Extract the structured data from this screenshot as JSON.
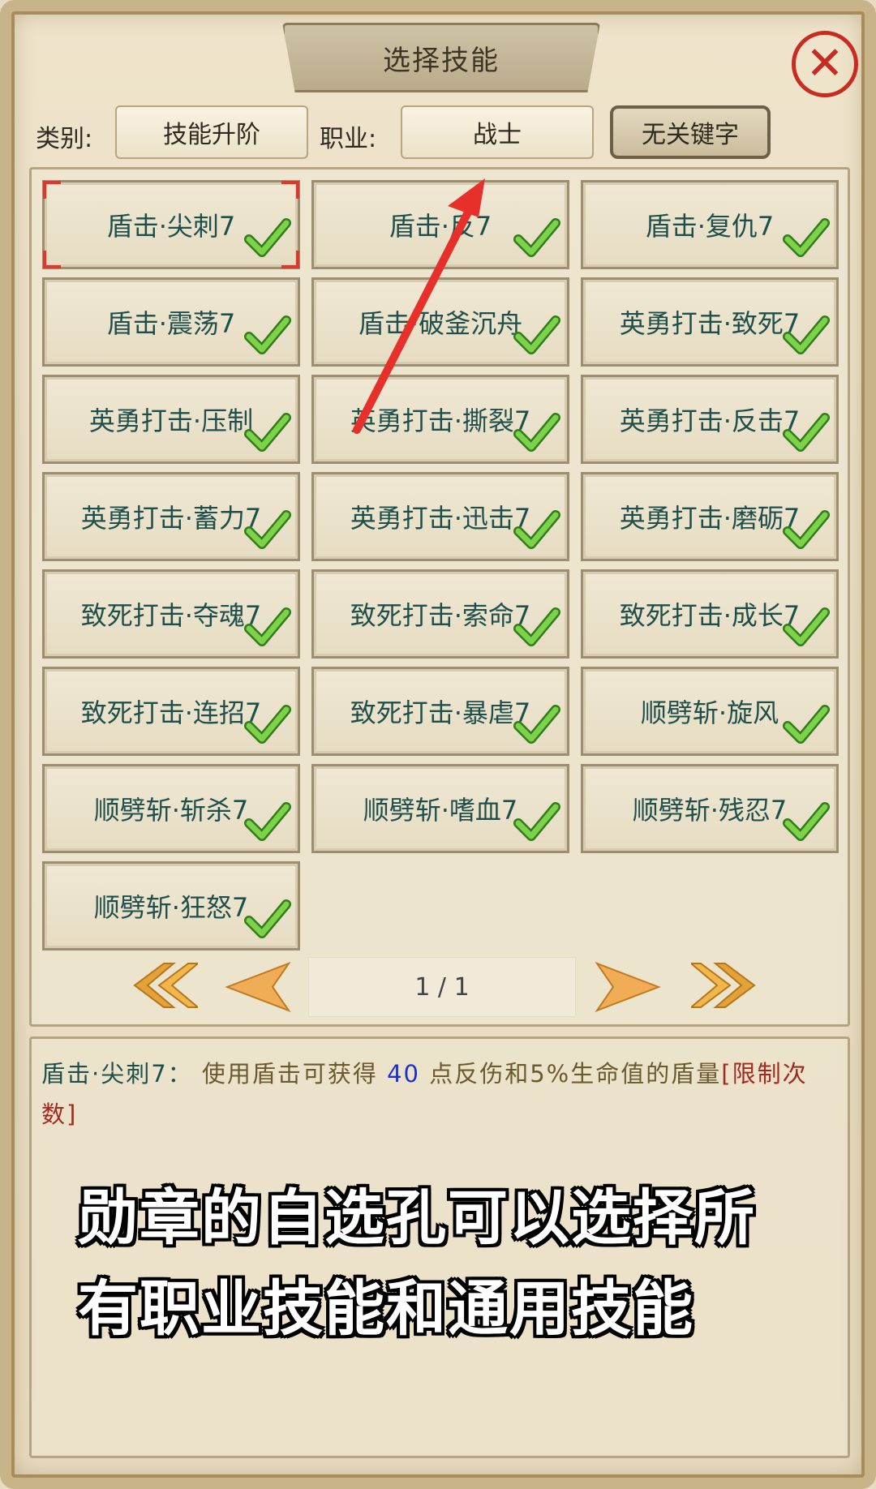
{
  "dialog": {
    "title": "选择技能",
    "close_icon": "close-x-icon",
    "accent_color": "#c92a22"
  },
  "filters": {
    "category_label": "类别:",
    "category_value": "技能升阶",
    "class_label": "职业:",
    "class_value": "战士",
    "keyword_button": "无关键字"
  },
  "skills": [
    {
      "name": "盾击·尖刺7",
      "checked": true,
      "selected": true
    },
    {
      "name": "盾击·反7",
      "checked": true,
      "selected": false
    },
    {
      "name": "盾击·复仇7",
      "checked": true,
      "selected": false
    },
    {
      "name": "盾击·震荡7",
      "checked": true,
      "selected": false
    },
    {
      "name": "盾击·破釜沉舟",
      "checked": true,
      "selected": false
    },
    {
      "name": "英勇打击·致死7",
      "checked": true,
      "selected": false
    },
    {
      "name": "英勇打击·压制",
      "checked": true,
      "selected": false
    },
    {
      "name": "英勇打击·撕裂7",
      "checked": true,
      "selected": false
    },
    {
      "name": "英勇打击·反击7",
      "checked": true,
      "selected": false
    },
    {
      "name": "英勇打击·蓄力7",
      "checked": true,
      "selected": false
    },
    {
      "name": "英勇打击·迅击7",
      "checked": true,
      "selected": false
    },
    {
      "name": "英勇打击·磨砺7",
      "checked": true,
      "selected": false
    },
    {
      "name": "致死打击·夺魂7",
      "checked": true,
      "selected": false
    },
    {
      "name": "致死打击·索命7",
      "checked": true,
      "selected": false
    },
    {
      "name": "致死打击·成长7",
      "checked": true,
      "selected": false
    },
    {
      "name": "致死打击·连招7",
      "checked": true,
      "selected": false
    },
    {
      "name": "致死打击·暴虐7",
      "checked": true,
      "selected": false
    },
    {
      "name": "顺劈斩·旋风",
      "checked": true,
      "selected": false
    },
    {
      "name": "顺劈斩·斩杀7",
      "checked": true,
      "selected": false
    },
    {
      "name": "顺劈斩·嗜血7",
      "checked": true,
      "selected": false
    },
    {
      "name": "顺劈斩·残忍7",
      "checked": true,
      "selected": false
    },
    {
      "name": "顺劈斩·狂怒7",
      "checked": true,
      "selected": false
    }
  ],
  "pager": {
    "page_text": "1 / 1",
    "first_icon": "double-chevron-left-icon",
    "prev_icon": "arrow-left-icon",
    "next_icon": "arrow-right-icon",
    "last_icon": "double-chevron-right-icon"
  },
  "description": {
    "skill_name": "盾击·尖刺7：",
    "text_before": " 使用盾击可获得 ",
    "number": "40",
    "text_after": " 点反伤和5%生命值的盾量",
    "limit": "[限制次数]"
  },
  "caption": {
    "line1": "勋章的自选孔可以选择所",
    "line2": "有职业技能和通用技能"
  },
  "annotation": {
    "arrow_icon": "red-arrow-annotation",
    "arrow_color": "#e8302a"
  }
}
